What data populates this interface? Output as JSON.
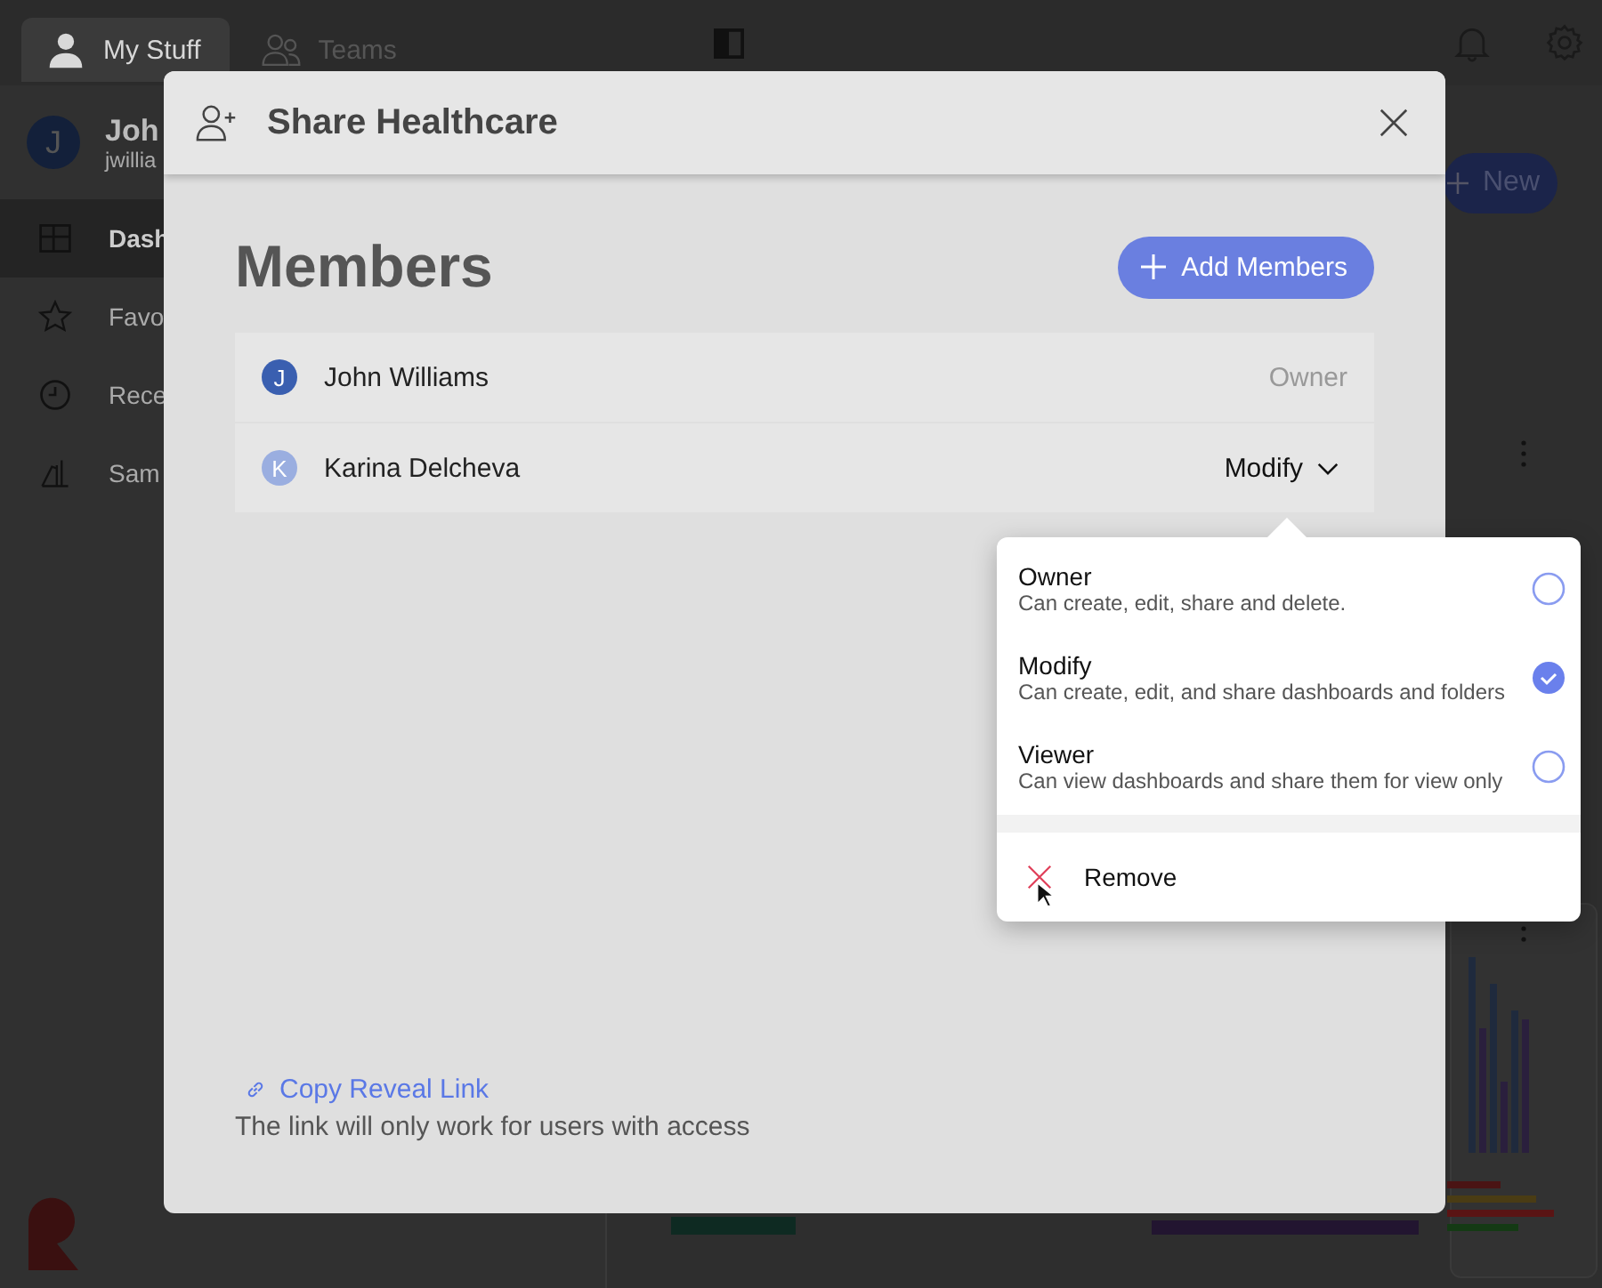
{
  "topbar": {
    "tabs": [
      {
        "label": "My Stuff",
        "selected": true
      },
      {
        "label": "Teams",
        "selected": false
      }
    ]
  },
  "sidebar": {
    "user": {
      "initial": "J",
      "name": "Joh",
      "email": "jwillia"
    },
    "items": [
      {
        "label": "Dash",
        "selected": true
      },
      {
        "label": "Favo",
        "selected": false
      },
      {
        "label": "Rece",
        "selected": false
      },
      {
        "label": "Sam",
        "selected": false
      }
    ]
  },
  "new_button": "New",
  "dialog": {
    "title": "Share Healthcare",
    "heading": "Members",
    "add_button": "Add Members",
    "members": [
      {
        "initial": "J",
        "name": "John Williams",
        "role": "Owner",
        "editable": false,
        "color": "#3a5fb0"
      },
      {
        "initial": "K",
        "name": "Karina Delcheva",
        "role": "Modify",
        "editable": true,
        "color": "#9aaee0"
      }
    ],
    "link": "Copy Reveal Link",
    "note": "The link will only work for users with access"
  },
  "role_menu": {
    "options": [
      {
        "title": "Owner",
        "description": "Can create, edit, share and delete.",
        "selected": false
      },
      {
        "title": "Modify",
        "description": "Can create, edit, and share dashboards and folders",
        "selected": true
      },
      {
        "title": "Viewer",
        "description": "Can view dashboards and share them for view only",
        "selected": false
      }
    ],
    "remove": "Remove"
  }
}
